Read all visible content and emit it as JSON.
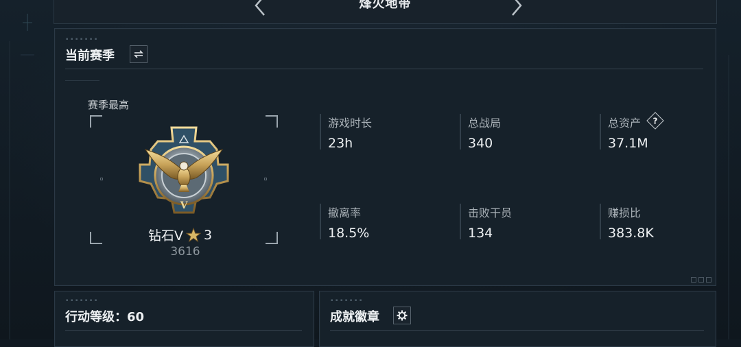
{
  "header": {
    "title": "烽火地带"
  },
  "season_panel": {
    "title": "当前赛季",
    "season_best_label": "赛季最高",
    "rank": {
      "name": "钻石V",
      "stars": "3",
      "score": "3616"
    },
    "stats": [
      {
        "label": "游戏时长",
        "value": "23h"
      },
      {
        "label": "总战局",
        "value": "340"
      },
      {
        "label": "总资产",
        "value": "37.1M",
        "help": "?"
      },
      {
        "label": "撤离率",
        "value": "18.5%"
      },
      {
        "label": "击败干员",
        "value": "134"
      },
      {
        "label": "赚损比",
        "value": "383.8K"
      }
    ]
  },
  "level_panel": {
    "title": "行动等级：60"
  },
  "badge_panel": {
    "title": "成就徽章"
  },
  "icons": {
    "prev": "chevron-left-icon",
    "next": "chevron-right-icon",
    "switch": "swap-icon",
    "settings": "gear-icon",
    "help": "question-icon",
    "rank_emblem": "eagle-emblem-icon",
    "star": "star-icon"
  },
  "colors": {
    "background": "#111a22",
    "panel": "#16212a",
    "border": "#2b3946",
    "gold": "#c9a45a"
  }
}
